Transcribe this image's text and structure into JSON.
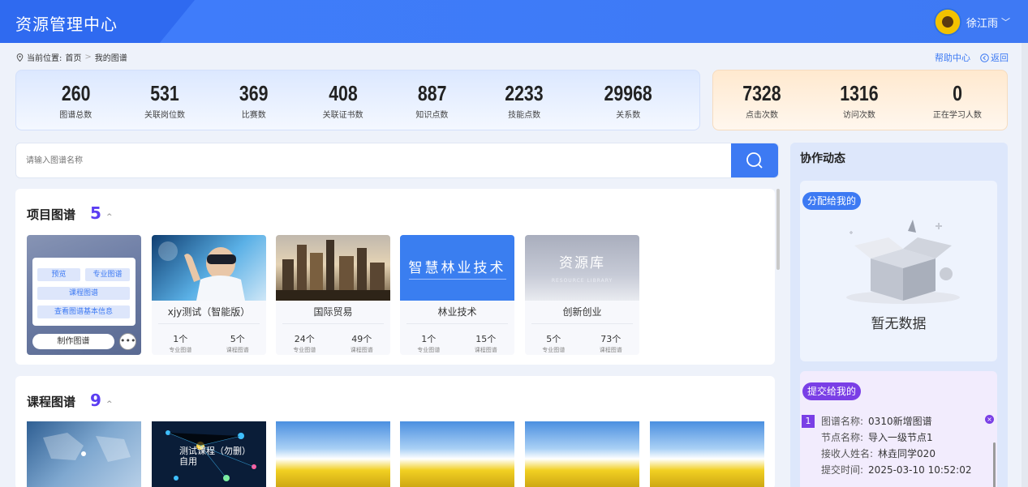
{
  "header": {
    "title": "资源管理中心",
    "user_name": "徐江雨",
    "chevron": "﹀"
  },
  "breadcrumb": {
    "prefix": "当前位置:",
    "home": "首页",
    "current": "我的图谱",
    "separator": ">"
  },
  "top_links": {
    "help": "帮助中心",
    "back": "返回"
  },
  "stats_primary": [
    {
      "value": "260",
      "label": "图谱总数"
    },
    {
      "value": "531",
      "label": "关联岗位数"
    },
    {
      "value": "369",
      "label": "比赛数"
    },
    {
      "value": "408",
      "label": "关联证书数"
    },
    {
      "value": "887",
      "label": "知识点数"
    },
    {
      "value": "2233",
      "label": "技能点数"
    },
    {
      "value": "29968",
      "label": "关系数"
    }
  ],
  "stats_secondary": [
    {
      "value": "7328",
      "label": "点击次数"
    },
    {
      "value": "1316",
      "label": "访问次数"
    },
    {
      "value": "0",
      "label": "正在学习人数"
    }
  ],
  "search": {
    "placeholder": "请输入图谱名称",
    "icon": "search-icon"
  },
  "project_section": {
    "title": "项目图谱",
    "count": "5",
    "collapse_icon": "^",
    "hover_menu": {
      "preview": "预览",
      "major": "专业图谱",
      "course": "课程图谱",
      "info": "查看图谱基本信息",
      "make": "制作图谱",
      "more": "•••"
    },
    "cards": [
      {
        "name": "xjy测试（智能版）",
        "major": "1个",
        "course": "5个",
        "major_label": "专业图谱",
        "course_label": "课程图谱"
      },
      {
        "name": "国际贸易",
        "major": "24个",
        "course": "49个",
        "major_label": "专业图谱",
        "course_label": "课程图谱"
      },
      {
        "name": "林业技术",
        "major": "1个",
        "course": "15个",
        "major_label": "专业图谱",
        "course_label": "课程图谱",
        "thumb_text": "智慧林业技术"
      },
      {
        "name": "创新创业",
        "major": "5个",
        "course": "73个",
        "major_label": "专业图谱",
        "course_label": "课程图谱",
        "thumb_text": "资源库",
        "thumb_sub": "RESOURCE LIBRARY"
      }
    ]
  },
  "course_section": {
    "title": "课程图谱",
    "count": "9",
    "collapse_icon": "^",
    "thumb2_text": "测试课程（勿删）自用"
  },
  "side": {
    "title": "协作动态",
    "assigned": {
      "tag": "分配给我的",
      "empty": "暂无数据"
    },
    "submitted": {
      "tag": "提交给我的",
      "item": {
        "index": "1",
        "rows": [
          {
            "k": "图谱名称:",
            "v": "0310新增图谱"
          },
          {
            "k": "节点名称:",
            "v": "导入一级节点1"
          },
          {
            "k": "接收人姓名:",
            "v": "林垚同学020"
          },
          {
            "k": "提交时间:",
            "v": "2025-03-10 10:52:02"
          }
        ],
        "close": "×"
      }
    }
  },
  "colors": {
    "primary": "#3d7af3",
    "purple": "#7a3fe6",
    "count": "#5b3df2"
  }
}
